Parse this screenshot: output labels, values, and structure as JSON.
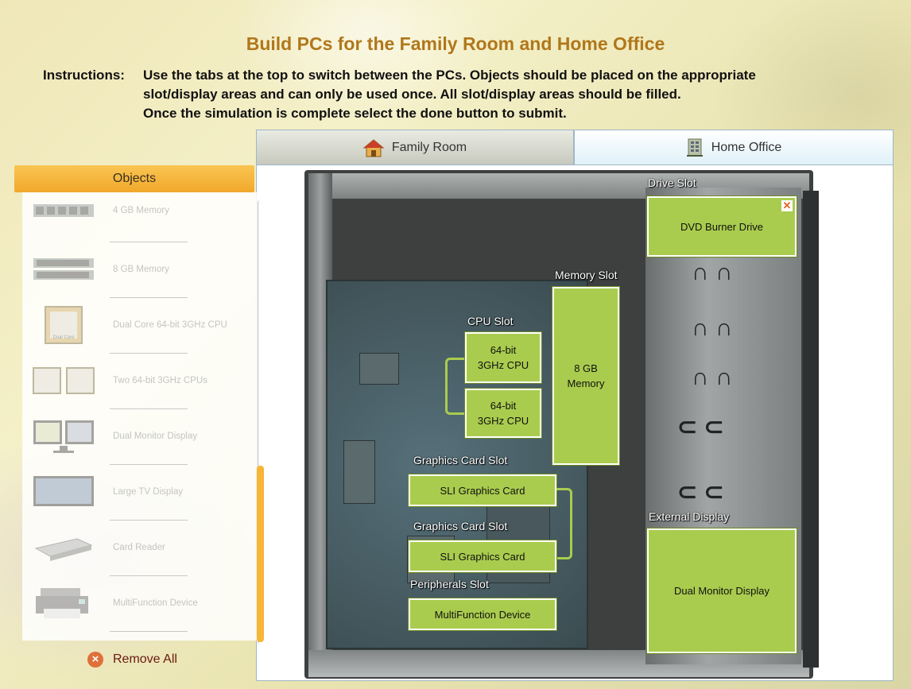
{
  "page": {
    "title": "Build PCs for the Family Room and Home Office",
    "instructions_label": "Instructions:",
    "instructions_line1": "Use the tabs at the top to switch between the PCs. Objects should be placed on the appropriate",
    "instructions_line2": "slot/display areas and can only be used once. All slot/display areas should be filled.",
    "instructions_line3": "Once the simulation is complete select the done button to submit."
  },
  "tabs": [
    {
      "label": "Family Room",
      "icon": "house-icon",
      "active": false
    },
    {
      "label": "Home Office",
      "icon": "office-building-icon",
      "active": true
    }
  ],
  "objects_panel": {
    "header": "Objects",
    "items": [
      {
        "label": "4 GB Memory",
        "icon": "memory-stick-icon"
      },
      {
        "label": "8 GB Memory",
        "icon": "memory-stick-icon"
      },
      {
        "label": "Dual Core 64-bit 3GHz CPU",
        "icon": "cpu-icon",
        "chip_text": "Dual Core"
      },
      {
        "label": "Two 64-bit 3GHz CPUs",
        "icon": "dual-cpu-icon"
      },
      {
        "label": "Dual Monitor Display",
        "icon": "dual-monitor-icon"
      },
      {
        "label": "Large TV Display",
        "icon": "tv-icon"
      },
      {
        "label": "Card Reader",
        "icon": "card-reader-icon"
      },
      {
        "label": "MultiFunction Device",
        "icon": "printer-icon"
      }
    ],
    "remove_all_label": "Remove All"
  },
  "slots": {
    "drive_slot": {
      "label": "Drive Slot",
      "value": "DVD Burner Drive"
    },
    "memory_slot": {
      "label": "Memory Slot",
      "value_line1": "8 GB",
      "value_line2": "Memory"
    },
    "cpu_slot": {
      "label": "CPU Slot",
      "cpu1_line1": "64-bit",
      "cpu1_line2": "3GHz CPU",
      "cpu2_line1": "64-bit",
      "cpu2_line2": "3GHz CPU"
    },
    "graphics_slot_1": {
      "label": "Graphics Card Slot",
      "value": "SLI Graphics Card"
    },
    "graphics_slot_2": {
      "label": "Graphics Card Slot",
      "value": "SLI Graphics Card"
    },
    "peripherals_slot": {
      "label": "Peripherals Slot",
      "value": "MultiFunction Device"
    },
    "external_display": {
      "label": "External Display",
      "value": "Dual Monitor Display"
    }
  },
  "colors": {
    "title": "#b0771b",
    "slot_fill": "#a9cc4e",
    "objects_header": "#f1a82b",
    "remove_icon": "#e0703a"
  }
}
